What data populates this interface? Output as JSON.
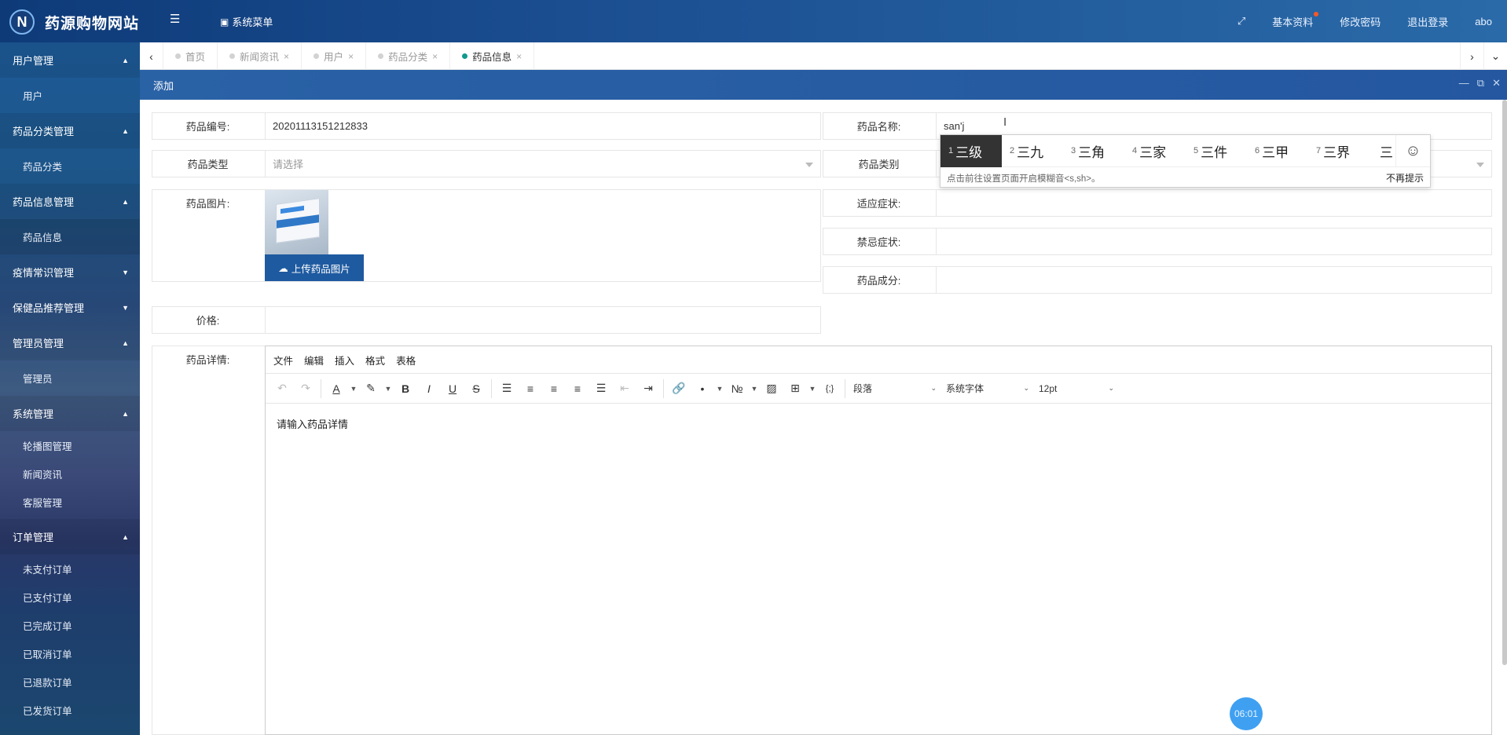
{
  "header": {
    "logo_letter": "N",
    "title": "药源购物网站",
    "system_menu": "系统菜单",
    "right_items": [
      "基本资料",
      "修改密码",
      "退出登录",
      "abo"
    ]
  },
  "sidebar": {
    "groups": [
      {
        "label": "用户管理",
        "arrow": "▲",
        "items": [
          "用户"
        ]
      },
      {
        "label": "药品分类管理",
        "arrow": "▲",
        "items": [
          "药品分类"
        ]
      },
      {
        "label": "药品信息管理",
        "arrow": "▲",
        "items": [
          "药品信息"
        ]
      },
      {
        "label": "疫情常识管理",
        "arrow": "▼",
        "items": []
      },
      {
        "label": "保健品推荐管理",
        "arrow": "▼",
        "items": []
      },
      {
        "label": "管理员管理",
        "arrow": "▲",
        "items": [
          "管理员"
        ]
      },
      {
        "label": "系统管理",
        "arrow": "▲",
        "items": [
          "轮播图管理",
          "新闻资讯",
          "客服管理"
        ]
      },
      {
        "label": "订单管理",
        "arrow": "▲",
        "items": [
          "未支付订单",
          "已支付订单",
          "已完成订单",
          "已取消订单",
          "已退款订单",
          "已发货订单"
        ]
      }
    ]
  },
  "tabs": [
    {
      "label": "首页",
      "active": false
    },
    {
      "label": "新闻资讯",
      "active": false
    },
    {
      "label": "用户",
      "active": false
    },
    {
      "label": "药品分类",
      "active": false
    },
    {
      "label": "药品信息",
      "active": true
    }
  ],
  "panel": {
    "title": "添加"
  },
  "form": {
    "code_label": "药品编号:",
    "code_value": "20201113151212833",
    "name_label": "药品名称:",
    "name_value": "san'j",
    "type_label": "药品类型",
    "type_placeholder": "请选择",
    "category_label": "药品类别",
    "image_label": "药品图片:",
    "upload_label": "上传药品图片",
    "indication_label": "适应症状:",
    "contra_label": "禁忌症状:",
    "ingredient_label": "药品成分:",
    "price_label": "价格:",
    "detail_label": "药品详情:"
  },
  "editor": {
    "menus": [
      "文件",
      "编辑",
      "插入",
      "格式",
      "表格"
    ],
    "paragraph": "段落",
    "font": "系统字体",
    "size": "12pt",
    "placeholder": "请输入药品详情"
  },
  "ime": {
    "candidates": [
      {
        "n": "1",
        "text": "三级"
      },
      {
        "n": "2",
        "text": "三九"
      },
      {
        "n": "3",
        "text": "三角"
      },
      {
        "n": "4",
        "text": "三家"
      },
      {
        "n": "5",
        "text": "三件"
      },
      {
        "n": "6",
        "text": "三甲"
      },
      {
        "n": "7",
        "text": "三界"
      },
      {
        "n": "",
        "text": "三"
      }
    ],
    "hint": "点击前往设置页面开启模糊音<s,sh>。",
    "dismiss": "不再提示"
  },
  "timer": "06:01"
}
